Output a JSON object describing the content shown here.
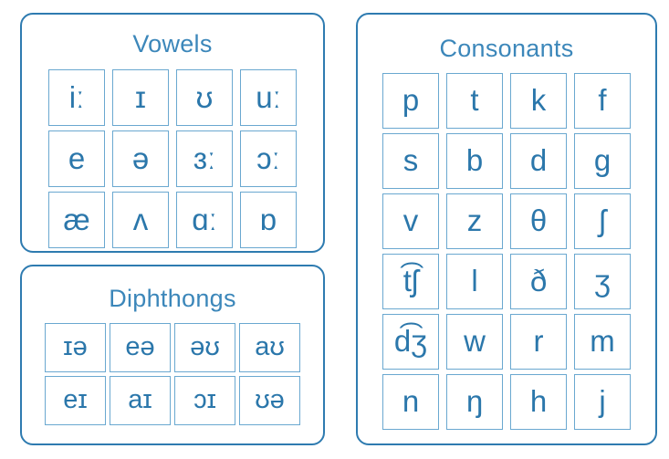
{
  "colors": {
    "panel_border": "#2e7bb0",
    "cell_border": "#6aa8d0",
    "symbol": "#2b77ab",
    "title": "#3c87ba",
    "background": "#ffffff"
  },
  "panels": {
    "vowels": {
      "title": "Vowels",
      "columns": 4,
      "rows": [
        [
          "iː",
          "ɪ",
          "ʊ",
          "uː"
        ],
        [
          "e",
          "ə",
          "ɜː",
          "ɔː"
        ],
        [
          "æ",
          "ʌ",
          "ɑː",
          "ɒ"
        ]
      ],
      "symbols": [
        "iː",
        "ɪ",
        "ʊ",
        "uː",
        "e",
        "ə",
        "ɜː",
        "ɔː",
        "æ",
        "ʌ",
        "ɑː",
        "ɒ"
      ],
      "count": 12
    },
    "diphthongs": {
      "title": "Diphthongs",
      "columns": 4,
      "rows": [
        [
          "ɪə",
          "eə",
          "əʊ",
          "aʊ"
        ],
        [
          "eɪ",
          "aɪ",
          "ɔɪ",
          "ʊə"
        ]
      ],
      "symbols": [
        "ɪə",
        "eə",
        "əʊ",
        "aʊ",
        "eɪ",
        "aɪ",
        "ɔɪ",
        "ʊə"
      ],
      "count": 8
    },
    "consonants": {
      "title": "Consonants",
      "columns": 4,
      "rows": [
        [
          "p",
          "t",
          "k",
          "f"
        ],
        [
          "s",
          "b",
          "d",
          "g"
        ],
        [
          "v",
          "z",
          "θ",
          "ʃ"
        ],
        [
          "t͡ʃ",
          "l",
          "ð",
          "ʒ"
        ],
        [
          "d͡ʒ",
          "w",
          "r",
          "m"
        ],
        [
          "n",
          "ŋ",
          "h",
          "j"
        ]
      ],
      "symbols": [
        "p",
        "t",
        "k",
        "f",
        "s",
        "b",
        "d",
        "g",
        "v",
        "z",
        "θ",
        "ʃ",
        "t͡ʃ",
        "l",
        "ð",
        "ʒ",
        "d͡ʒ",
        "w",
        "r",
        "m",
        "n",
        "ŋ",
        "h",
        "j"
      ],
      "count": 24
    }
  }
}
